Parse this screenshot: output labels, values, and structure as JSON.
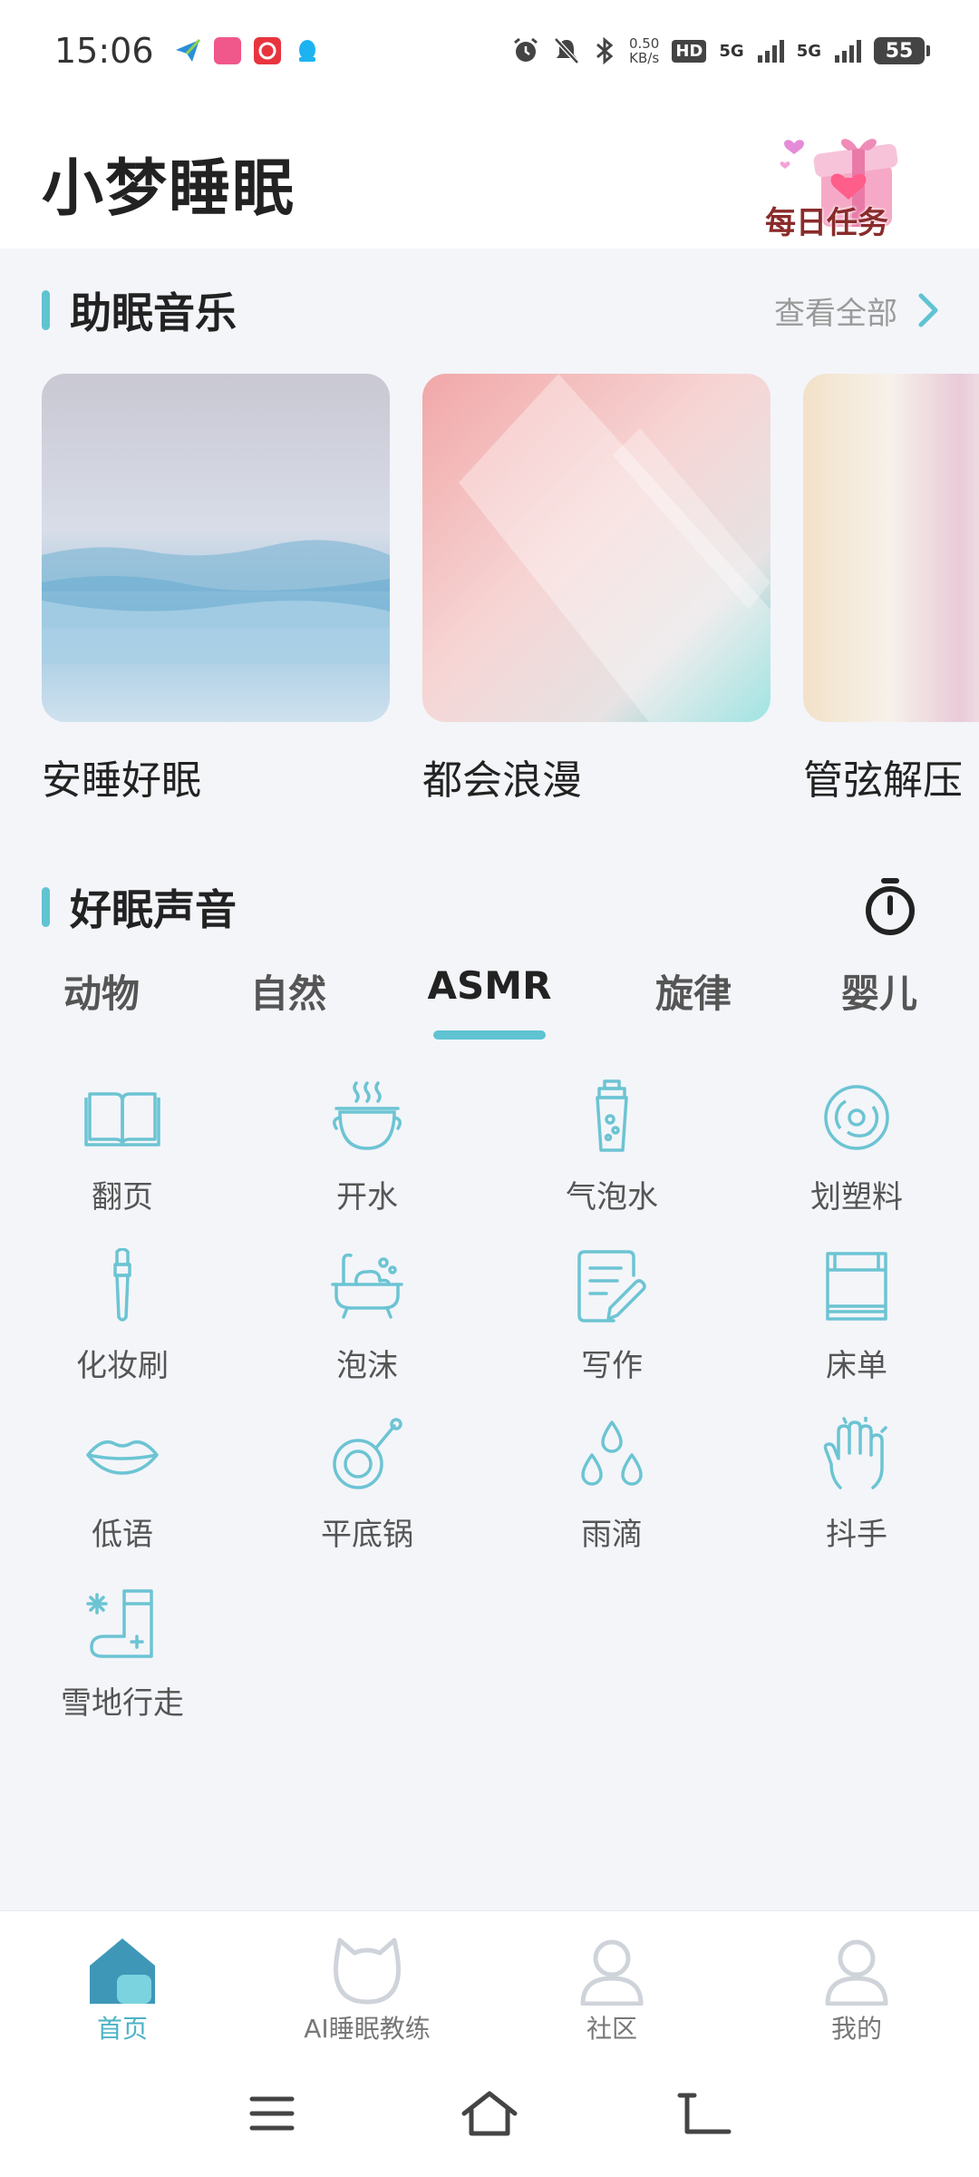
{
  "status_bar": {
    "time": "15:06",
    "speed_value": "0.50",
    "speed_unit": "KB/s",
    "network_1": "5G",
    "network_2": "5G",
    "hd_label": "HD",
    "battery": "55",
    "icons": [
      "paper-plane-app-icon",
      "bilibili-app-icon",
      "red-app-icon",
      "qq-app-icon",
      "alarm-icon",
      "mute-icon",
      "bluetooth-icon",
      "hd-icon",
      "signal-icon",
      "battery-icon"
    ]
  },
  "header": {
    "title": "小梦睡眠",
    "daily_task_label": "每日任务"
  },
  "music_section": {
    "title": "助眠音乐",
    "view_all": "查看全部",
    "cards": [
      {
        "title": "安睡好眠"
      },
      {
        "title": "都会浪漫"
      },
      {
        "title": "管弦解压"
      }
    ]
  },
  "sound_section": {
    "title": "好眠声音",
    "timer_icon": "timer-icon",
    "tabs": [
      {
        "label": "动物"
      },
      {
        "label": "自然"
      },
      {
        "label": "ASMR",
        "active": true
      },
      {
        "label": "旋律"
      },
      {
        "label": "婴儿"
      }
    ],
    "sounds": [
      {
        "label": "翻页",
        "icon": "book-icon"
      },
      {
        "label": "开水",
        "icon": "boiling-pot-icon"
      },
      {
        "label": "气泡水",
        "icon": "soda-icon"
      },
      {
        "label": "划塑料",
        "icon": "vinyl-icon"
      },
      {
        "label": "化妆刷",
        "icon": "makeup-brush-icon"
      },
      {
        "label": "泡沫",
        "icon": "bathtub-foam-icon"
      },
      {
        "label": "写作",
        "icon": "writing-icon"
      },
      {
        "label": "床单",
        "icon": "bedsheet-icon"
      },
      {
        "label": "低语",
        "icon": "lips-icon"
      },
      {
        "label": "平底锅",
        "icon": "frying-pan-icon"
      },
      {
        "label": "雨滴",
        "icon": "raindrops-icon"
      },
      {
        "label": "抖手",
        "icon": "shaking-hand-icon"
      },
      {
        "label": "雪地行走",
        "icon": "snow-boot-icon"
      }
    ]
  },
  "bottom_nav": {
    "items": [
      {
        "label": "首页",
        "icon": "home-icon",
        "active": true
      },
      {
        "label": "AI睡眠教练",
        "icon": "cat-coach-icon"
      },
      {
        "label": "社区",
        "icon": "person-icon"
      },
      {
        "label": "我的",
        "icon": "profile-icon"
      }
    ]
  },
  "colors": {
    "accent": "#5fc3d2",
    "icon_stroke": "#6cc4d3",
    "background": "#f3f5f9"
  }
}
